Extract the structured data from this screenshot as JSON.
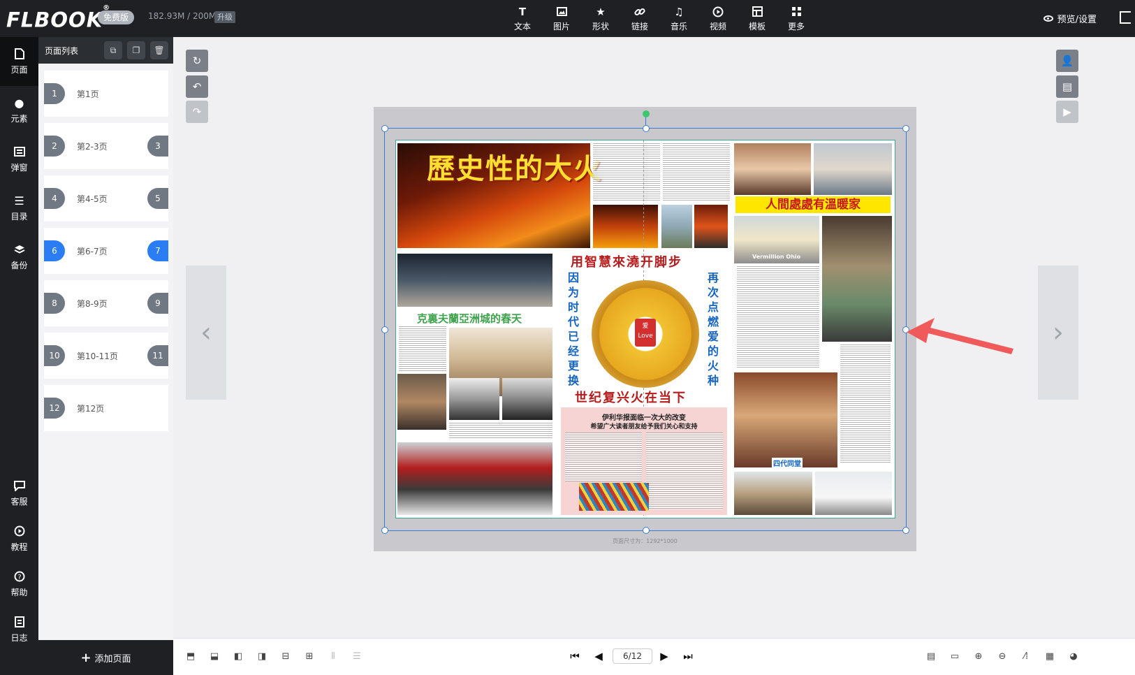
{
  "topbar": {
    "logo": "FLBOOK",
    "plan_badge": "免费版",
    "storage": "182.93M / 200M",
    "upgrade": "升级",
    "tools": [
      {
        "label": "文本",
        "icon": "text-icon"
      },
      {
        "label": "图片",
        "icon": "image-icon"
      },
      {
        "label": "形状",
        "icon": "star-icon"
      },
      {
        "label": "链接",
        "icon": "link-icon"
      },
      {
        "label": "音乐",
        "icon": "music-icon"
      },
      {
        "label": "视频",
        "icon": "play-circle-icon"
      },
      {
        "label": "模板",
        "icon": "template-icon"
      },
      {
        "label": "更多",
        "icon": "more-grid-icon"
      }
    ],
    "preview_settings": "预览/设置"
  },
  "leftnav": {
    "items": [
      {
        "label": "页面",
        "icon": "page-icon"
      },
      {
        "label": "元素",
        "icon": "elements-icon"
      },
      {
        "label": "弹窗",
        "icon": "popup-icon"
      },
      {
        "label": "目录",
        "icon": "list-icon"
      },
      {
        "label": "备份",
        "icon": "layers-icon"
      },
      {
        "label": "客服",
        "icon": "chat-icon"
      },
      {
        "label": "教程",
        "icon": "play-icon"
      },
      {
        "label": "帮助",
        "icon": "help-icon"
      },
      {
        "label": "日志",
        "icon": "log-icon"
      }
    ]
  },
  "pagepanel": {
    "title": "页面列表",
    "pages": [
      {
        "num": "1",
        "name": "第1页",
        "num2": "",
        "active": false
      },
      {
        "num": "2",
        "name": "第2-3页",
        "num2": "3",
        "active": false
      },
      {
        "num": "4",
        "name": "第4-5页",
        "num2": "5",
        "active": false
      },
      {
        "num": "6",
        "name": "第6-7页",
        "num2": "7",
        "active": true
      },
      {
        "num": "8",
        "name": "第8-9页",
        "num2": "9",
        "active": false
      },
      {
        "num": "10",
        "name": "第10-11页",
        "num2": "11",
        "active": false
      },
      {
        "num": "12",
        "name": "第12页",
        "num2": "",
        "active": false
      }
    ],
    "add_page": "添加页面"
  },
  "canvas": {
    "page_size_label": "页面尺寸为：1292*1000",
    "newspaper": {
      "headline_fire": "歷史性的大火",
      "headline_home": "人間處處有溫暖家",
      "headline_spring": "克裏夫蘭亞洲城的春天",
      "center_top": "用智慧來澆开脚步",
      "center_bottom": "世纪复兴火在当下",
      "left_vertical": "因为时代已经更换",
      "right_vertical": "再次点燃爱的火种",
      "wheel_core": "爱 Love",
      "vermillion_caption": "Vermillion Ohio",
      "family_caption": "四代同堂",
      "change_title": "伊利华报面临一次大的改变",
      "change_subtitle": "希望广大读者朋友给予我们关心和支持"
    }
  },
  "bottombar": {
    "page_indicator": "6/12"
  }
}
